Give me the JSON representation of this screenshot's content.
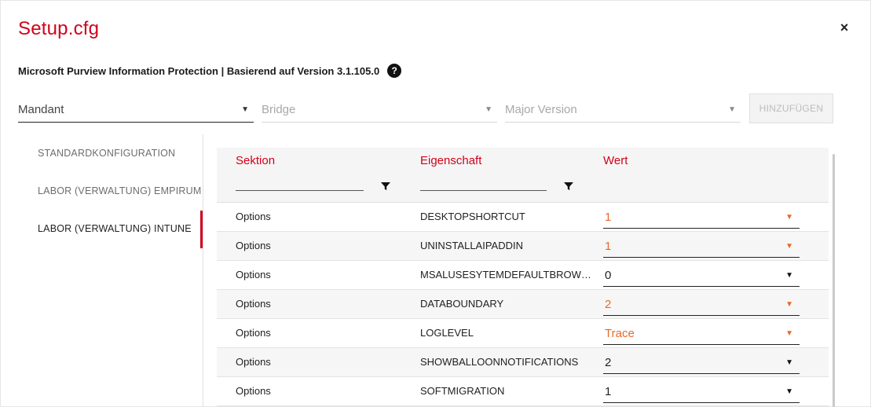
{
  "dialog": {
    "title": "Setup.cfg",
    "subtitle": "Microsoft Purview Information Protection | Basierend auf Version 3.1.105.0",
    "close_label": "×",
    "help_label": "?"
  },
  "filters": {
    "mandant": "Mandant",
    "bridge": "Bridge",
    "major_version": "Major Version",
    "add_button": "HINZUFÜGEN",
    "caret": "▼"
  },
  "sidebar": {
    "items": [
      {
        "label": "STANDARDKONFIGURATION",
        "active": false
      },
      {
        "label": "LABOR (VERWALTUNG) EMPIRUM",
        "active": false
      },
      {
        "label": "LABOR (VERWALTUNG) INTUNE",
        "active": true
      }
    ]
  },
  "table": {
    "headers": {
      "section": "Sektion",
      "property": "Eigenschaft",
      "value": "Wert"
    },
    "rows": [
      {
        "section": "Options",
        "property": "DESKTOPSHORTCUT",
        "value": "1",
        "modified": true
      },
      {
        "section": "Options",
        "property": "UNINSTALLAIPADDIN",
        "value": "1",
        "modified": true
      },
      {
        "section": "Options",
        "property": "MSALUSESYTEMDEFAULTBROW…",
        "value": "0",
        "modified": false
      },
      {
        "section": "Options",
        "property": "DATABOUNDARY",
        "value": "2",
        "modified": true
      },
      {
        "section": "Options",
        "property": "LOGLEVEL",
        "value": "Trace",
        "modified": true
      },
      {
        "section": "Options",
        "property": "SHOWBALLOONNOTIFICATIONS",
        "value": "2",
        "modified": false
      },
      {
        "section": "Options",
        "property": "SOFTMIGRATION",
        "value": "1",
        "modified": false
      }
    ]
  },
  "colors": {
    "accent": "#d0021b",
    "modified_value": "#e8692c"
  },
  "icons": {
    "close": "close-icon",
    "help": "help-icon",
    "filter": "filter-icon",
    "dropdown": "chevron-down-icon"
  }
}
